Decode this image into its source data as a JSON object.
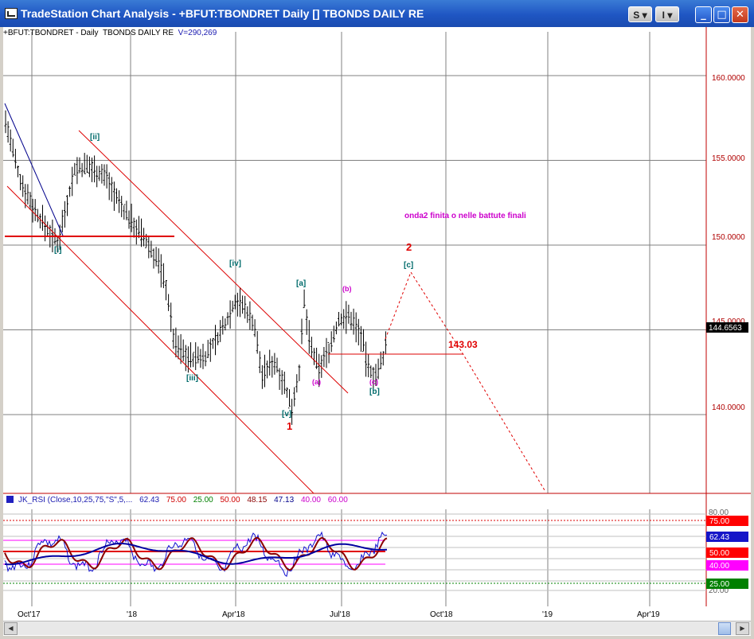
{
  "window": {
    "title": "TradeStation Chart Analysis - +BFUT:TBONDRET Daily [] TBONDS DAILY RE",
    "buttons": {
      "s_label": "S",
      "i_label": "I",
      "dropdown_glyph": "▾",
      "minimize": "_",
      "maximize": "□",
      "close": "✕"
    }
  },
  "chart_info": {
    "symbol": "+BFUT:TBONDRET - Daily",
    "description": "TBONDS DAILY RE",
    "volume": "V=290,269"
  },
  "price_axis": {
    "labels": [
      "160.0000",
      "155.0000",
      "150.0000",
      "145.0000",
      "140.0000"
    ],
    "last_price": "144.6563"
  },
  "time_axis": {
    "labels": [
      "Oct'17",
      "'18",
      "Apr'18",
      "Jul'18",
      "Oct'18",
      "'19",
      "Apr'19"
    ]
  },
  "annotations": {
    "wave_labels": [
      "[i]",
      "[ii]",
      "[iii]",
      "[iv]",
      "[v]",
      "[a]",
      "[b]",
      "[c]",
      "(a)",
      "(b)",
      "(c)"
    ],
    "wave_one": "1",
    "wave_two": "2",
    "comment": "onda2 finita o nelle battute finali",
    "level_label": "143.03"
  },
  "rsi": {
    "legend": {
      "name": "JK_RSI (Close,10,25,75,\"S\",5,...",
      "values": [
        "62.43",
        "75.00",
        "25.00",
        "50.00",
        "48.15",
        "47.13",
        "40.00",
        "60.00"
      ]
    },
    "axis_labels": [
      "80.00",
      "20.00"
    ],
    "value_tags": [
      {
        "text": "75.00",
        "bg": "#ff0000",
        "fg": "#ffffff"
      },
      {
        "text": "62.43",
        "bg": "#1515c8",
        "fg": "#ffffff"
      },
      {
        "text": "50.00",
        "bg": "#ff0000",
        "fg": "#ffffff"
      },
      {
        "text": "40.00",
        "bg": "#ff00ff",
        "fg": "#ffffff"
      },
      {
        "text": "25.00",
        "bg": "#008000",
        "fg": "#ffffff"
      }
    ]
  },
  "colors": {
    "grid": "#808080",
    "price_bars": "#000000",
    "channel": "#dd0000",
    "trendline": "#00008b",
    "wave_teal": "#006b6b",
    "wave_magenta": "#cc00cc",
    "wave_red": "#e00000",
    "rsi_blue": "#1010d0",
    "rsi_darkred": "#8b0000",
    "rsi_navy": "#0000a0"
  },
  "scrollbar": {
    "left_arrow": "◀",
    "right_arrow": "▶"
  }
}
